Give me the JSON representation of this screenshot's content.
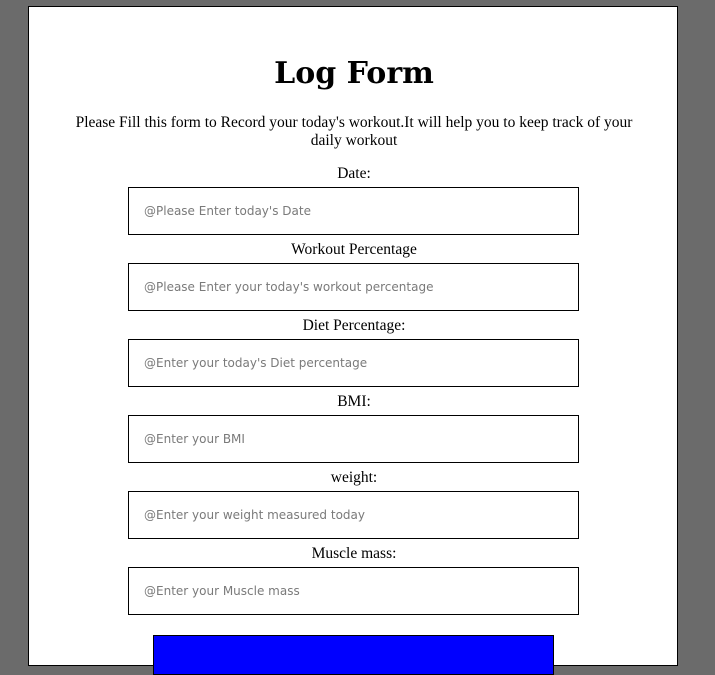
{
  "form": {
    "title": "Log Form",
    "description": "Please Fill this form to Record your today's workout.It will help you to keep track of your daily workout",
    "fields": [
      {
        "label": "Date:",
        "placeholder": "@Please Enter today's Date",
        "value": ""
      },
      {
        "label": "Workout Percentage",
        "placeholder": "@Please Enter your today's workout percentage",
        "value": ""
      },
      {
        "label": "Diet Percentage:",
        "placeholder": "@Enter your today's Diet percentage",
        "value": ""
      },
      {
        "label": "BMI:",
        "placeholder": "@Enter your BMI",
        "value": ""
      },
      {
        "label": "weight:",
        "placeholder": "@Enter your weight measured today",
        "value": ""
      },
      {
        "label": "Muscle mass:",
        "placeholder": "@Enter your Muscle mass",
        "value": ""
      }
    ],
    "submit": {
      "label": ""
    }
  },
  "colors": {
    "background": "#6b6b6b",
    "card": "#ffffff",
    "submit_button": "#0000ff"
  }
}
